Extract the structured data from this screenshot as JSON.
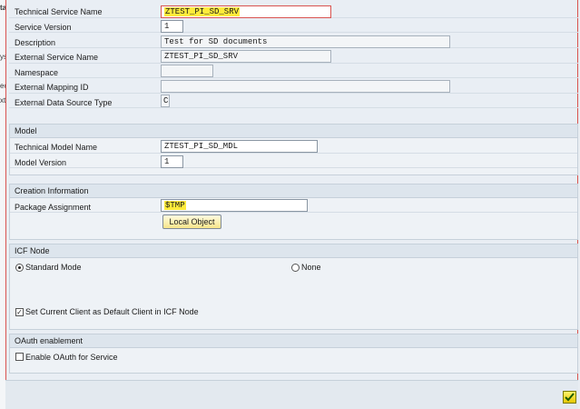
{
  "left_strip": [
    "ta",
    "ys",
    "ec",
    "xt"
  ],
  "service": {
    "tech_name_label": "Technical Service Name",
    "tech_name_value": "ZTEST_PI_SD_SRV",
    "version_label": "Service Version",
    "version_value": "1",
    "description_label": "Description",
    "description_value": "Test for SD documents",
    "ext_name_label": "External Service Name",
    "ext_name_value": "ZTEST_PI_SD_SRV",
    "namespace_label": "Namespace",
    "namespace_value": "",
    "ext_mapping_label": "External Mapping ID",
    "ext_mapping_value": "",
    "ext_source_label": "External Data Source Type",
    "ext_source_value": "C"
  },
  "model": {
    "header": "Model",
    "tech_name_label": "Technical Model Name",
    "tech_name_value": "ZTEST_PI_SD_MDL",
    "version_label": "Model Version",
    "version_value": "1"
  },
  "creation": {
    "header": "Creation Information",
    "package_label": "Package Assignment",
    "package_value": "$TMP",
    "local_object_label": "Local Object"
  },
  "icf": {
    "header": "ICF Node",
    "standard_label": "Standard Mode",
    "none_label": "None",
    "default_client_label": "Set Current Client as Default Client in ICF Node"
  },
  "oauth": {
    "header": "OAuth enablement",
    "enable_label": "Enable OAuth for Service"
  },
  "colors": {
    "highlight": "#ffeb3b",
    "focus_border": "#d9534f",
    "ok_button": "#e6c800"
  }
}
